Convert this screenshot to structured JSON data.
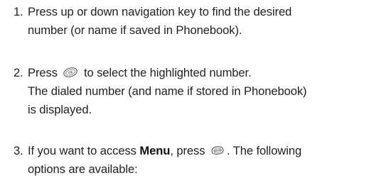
{
  "steps": [
    {
      "number": "1.",
      "lines": [
        "Press up or down navigation key to find the desired",
        "number (or name if saved in Phonebook)."
      ]
    },
    {
      "number": "2.",
      "prefix": "Press",
      "icon": "ok-key-icon",
      "suffix": "to select the highlighted number.",
      "lines": [
        "The dialed number (and name if stored in Phonebook)",
        "is displayed."
      ]
    },
    {
      "number": "3.",
      "prefix": "If you want to access",
      "bold": "Menu",
      "mid": ", press",
      "icon": "menu-key-icon",
      "suffix": ". The following",
      "lines": [
        "options are available:"
      ]
    }
  ],
  "colors": {
    "text": "#222222",
    "key_fill": "#e8e8e8",
    "key_stroke": "#555555"
  }
}
